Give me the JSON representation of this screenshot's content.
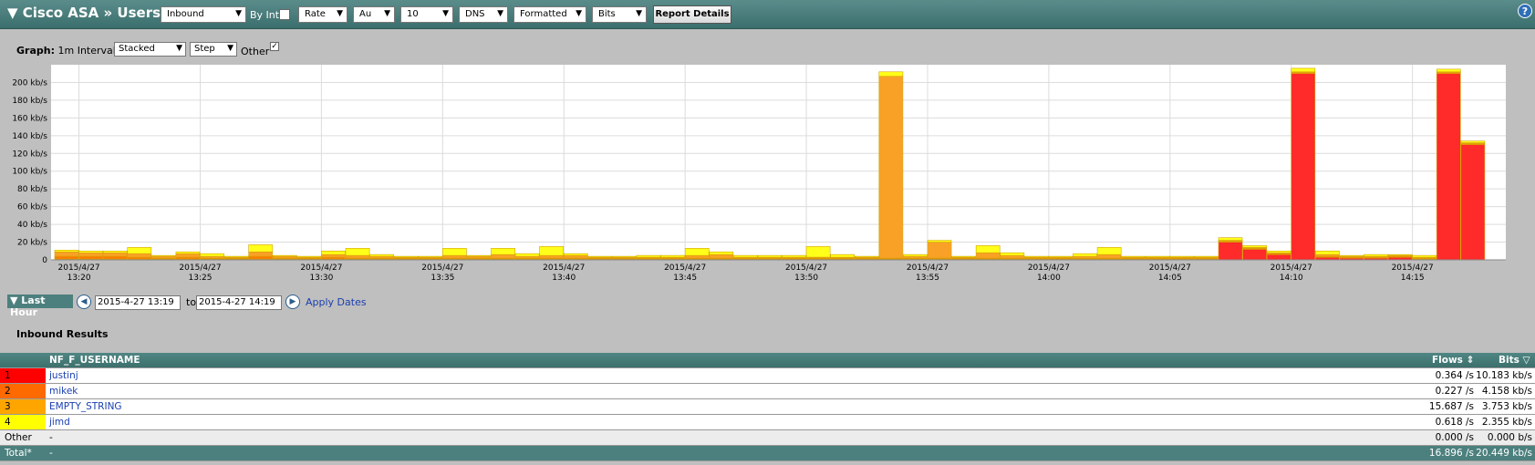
{
  "header": {
    "title": "▼ Cisco ASA » Users",
    "direction": "Inbound",
    "by_int_label": "By Int",
    "rate": "Rate",
    "au": "Au",
    "count": "10",
    "dns": "DNS",
    "formatted": "Formatted",
    "bits": "Bits",
    "report_details": "Report Details",
    "help": "?"
  },
  "graph_controls": {
    "label_bold": "Graph:",
    "label_rest": "1m Interval",
    "mode": "Stacked",
    "style": "Step",
    "other_label": "Other",
    "other_checked": true
  },
  "chart_data": {
    "type": "bar",
    "stacked": true,
    "yunit": "kb/s",
    "ylim": [
      0,
      220
    ],
    "yticks": [
      "0",
      "20 kb/s",
      "40 kb/s",
      "60 kb/s",
      "80 kb/s",
      "100 kb/s",
      "120 kb/s",
      "140 kb/s",
      "160 kb/s",
      "180 kb/s",
      "200 kb/s"
    ],
    "x_start": "13:19",
    "xticks": [
      {
        "min": 1,
        "date": "2015/4/27",
        "time": "13:20"
      },
      {
        "min": 6,
        "date": "2015/4/27",
        "time": "13:25"
      },
      {
        "min": 11,
        "date": "2015/4/27",
        "time": "13:30"
      },
      {
        "min": 16,
        "date": "2015/4/27",
        "time": "13:35"
      },
      {
        "min": 21,
        "date": "2015/4/27",
        "time": "13:40"
      },
      {
        "min": 26,
        "date": "2015/4/27",
        "time": "13:45"
      },
      {
        "min": 31,
        "date": "2015/4/27",
        "time": "13:50"
      },
      {
        "min": 36,
        "date": "2015/4/27",
        "time": "13:55"
      },
      {
        "min": 41,
        "date": "2015/4/27",
        "time": "14:00"
      },
      {
        "min": 46,
        "date": "2015/4/27",
        "time": "14:05"
      },
      {
        "min": 51,
        "date": "2015/4/27",
        "time": "14:10"
      },
      {
        "min": 56,
        "date": "2015/4/27",
        "time": "14:15"
      }
    ],
    "series": [
      {
        "name": "justinj",
        "color": "#ff2a2a",
        "values": [
          1,
          1,
          1,
          1,
          1,
          1,
          1,
          1,
          1,
          1,
          1,
          1,
          1,
          1,
          1,
          1,
          1,
          1,
          1,
          1,
          1,
          1,
          1,
          1,
          1,
          1,
          1,
          1,
          1,
          1,
          1,
          1,
          1,
          1,
          1,
          1,
          1,
          1,
          1,
          1,
          1,
          1,
          1,
          1,
          1,
          1,
          1,
          1,
          20,
          12,
          6,
          210,
          3,
          2,
          2,
          3,
          1,
          210,
          130
        ]
      },
      {
        "name": "mikek",
        "color": "#ff7a00",
        "values": [
          3,
          3,
          3,
          2,
          1,
          2,
          1,
          1,
          3,
          1,
          1,
          2,
          1,
          1,
          1,
          1,
          1,
          1,
          1,
          1,
          1,
          1,
          1,
          1,
          1,
          1,
          1,
          1,
          1,
          1,
          1,
          1,
          1,
          1,
          1,
          1,
          1,
          1,
          1,
          1,
          1,
          1,
          1,
          1,
          1,
          1,
          1,
          1,
          1,
          1,
          1,
          1,
          1,
          1,
          1,
          1,
          1,
          1,
          1
        ]
      },
      {
        "name": "EMPTY_STRING",
        "color": "#f9a126",
        "values": [
          5,
          4,
          4,
          4,
          2,
          4,
          2,
          1,
          5,
          2,
          1,
          3,
          3,
          2,
          1,
          1,
          3,
          2,
          4,
          2,
          3,
          3,
          1,
          1,
          1,
          1,
          3,
          4,
          1,
          1,
          1,
          1,
          1,
          1,
          205,
          2,
          18,
          1,
          6,
          3,
          1,
          1,
          2,
          4,
          1,
          1,
          1,
          1,
          1,
          1,
          1,
          1,
          2,
          1,
          1,
          1,
          1,
          1,
          1
        ]
      },
      {
        "name": "jimd",
        "color": "#ffff1a",
        "values": [
          2,
          2,
          2,
          7,
          1,
          2,
          3,
          1,
          8,
          1,
          1,
          4,
          8,
          2,
          1,
          1,
          8,
          1,
          7,
          3,
          10,
          2,
          1,
          1,
          2,
          2,
          8,
          3,
          2,
          2,
          2,
          12,
          3,
          1,
          5,
          2,
          2,
          1,
          8,
          3,
          1,
          1,
          3,
          8,
          1,
          1,
          1,
          1,
          3,
          2,
          2,
          4,
          4,
          1,
          2,
          1,
          2,
          3,
          2
        ]
      }
    ],
    "grid": true
  },
  "dates": {
    "last_hour": "▼ Last Hour",
    "from": "2015-4-27 13:19",
    "to_label": "to",
    "to": "2015-4-27 14:19",
    "apply": "Apply Dates"
  },
  "results": {
    "title": "Inbound Results",
    "columns": {
      "name": "NF_F_USERNAME",
      "flows": "Flows",
      "bits": "Bits"
    },
    "rows": [
      {
        "rank": "1",
        "name": "justinj",
        "flows": "0.364 /s",
        "bits": "10.183 kb/s",
        "color": "#ff0000"
      },
      {
        "rank": "2",
        "name": "mikek",
        "flows": "0.227 /s",
        "bits": "4.158 kb/s",
        "color": "#ff6a00"
      },
      {
        "rank": "3",
        "name": "EMPTY_STRING",
        "flows": "15.687 /s",
        "bits": "3.753 kb/s",
        "color": "#ffa500"
      },
      {
        "rank": "4",
        "name": "jimd",
        "flows": "0.618 /s",
        "bits": "2.355 kb/s",
        "color": "#ffff00"
      }
    ],
    "other": {
      "label": "Other",
      "name": "-",
      "flows": "0.000 /s",
      "bits": "0.000 b/s"
    },
    "total": {
      "label": "Total*",
      "name": "-",
      "flows": "16.896 /s",
      "bits": "20.449 kb/s"
    }
  }
}
